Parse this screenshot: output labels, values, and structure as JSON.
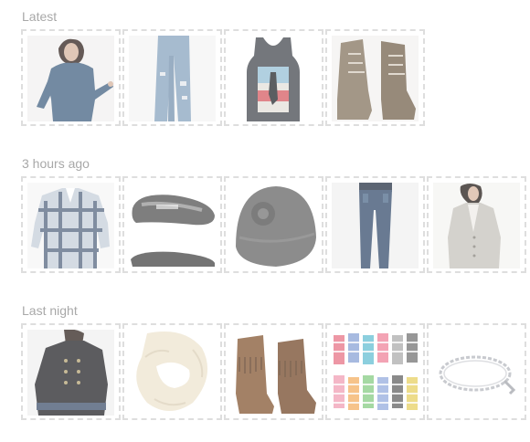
{
  "sections": [
    {
      "title": "Latest",
      "items": [
        {
          "name": "woman-blue-top-image"
        },
        {
          "name": "ripped-jeans-image"
        },
        {
          "name": "graphic-tank-top-image"
        },
        {
          "name": "lace-up-boots-image"
        }
      ]
    },
    {
      "title": "3 hours ago",
      "items": [
        {
          "name": "plaid-shirt-image"
        },
        {
          "name": "houndstooth-flats-image"
        },
        {
          "name": "knit-beanie-image"
        },
        {
          "name": "skinny-jeans-image"
        },
        {
          "name": "grey-cardigan-image"
        }
      ]
    },
    {
      "title": "Last night",
      "items": [
        {
          "name": "military-jacket-image"
        },
        {
          "name": "cream-knit-scarf-image"
        },
        {
          "name": "fringe-moccasin-boots-image"
        },
        {
          "name": "striped-socks-image"
        },
        {
          "name": "silver-bracelet-image"
        }
      ]
    }
  ],
  "colors": {
    "heading": "#a8a8a8",
    "thumb_border": "#dedede"
  }
}
